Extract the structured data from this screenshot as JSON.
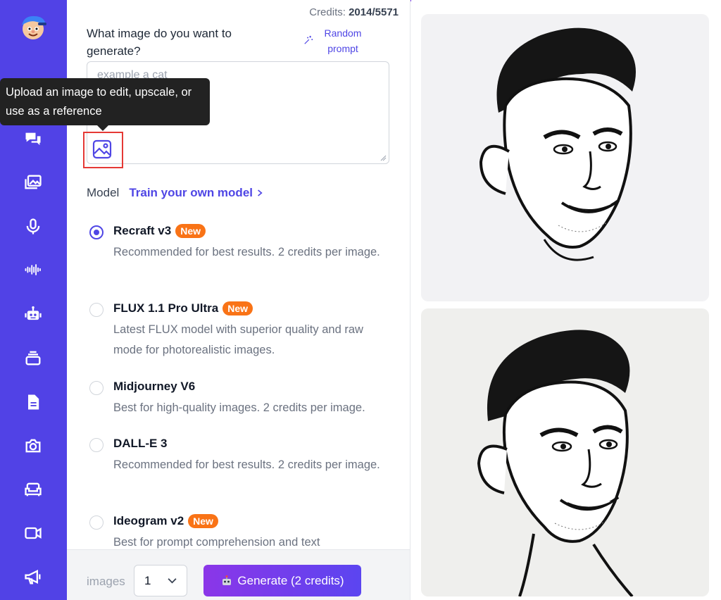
{
  "credits": {
    "label": "Credits:",
    "value": "2014/5571"
  },
  "prompt": {
    "question": "What image do you want to generate?",
    "placeholder": "example a cat",
    "value": "",
    "random_label": "Random prompt"
  },
  "tooltip": {
    "text": "Upload an image to edit, upscale, or use as a reference"
  },
  "model": {
    "label": "Model",
    "train_link": "Train your own model",
    "options": [
      {
        "name": "Recraft v3",
        "badge": "New",
        "description": "Recommended for best results. 2 credits per image.",
        "selected": true
      },
      {
        "name": "FLUX 1.1 Pro Ultra",
        "badge": "New",
        "description": "Latest FLUX model with superior quality and raw mode for photorealistic images.",
        "selected": false
      },
      {
        "name": "Midjourney V6",
        "badge": "",
        "description": "Best for high-quality images. 2 credits per image.",
        "selected": false
      },
      {
        "name": "DALL-E 3",
        "badge": "",
        "description": "Recommended for best results. 2 credits per image.",
        "selected": false
      },
      {
        "name": "Ideogram v2",
        "badge": "New",
        "description": "Best for prompt comprehension and text",
        "selected": false
      }
    ]
  },
  "footer": {
    "images_label": "images",
    "images_count": "1",
    "generate_label": "Generate (2 credits)"
  },
  "sidebar": {
    "icons": [
      "home-icon",
      "chat-icon",
      "images-icon",
      "microphone-icon",
      "waveform-icon",
      "robot-icon",
      "stack-icon",
      "document-icon",
      "camera-icon",
      "sofa-icon",
      "video-icon",
      "megaphone-icon"
    ]
  },
  "colors": {
    "sidebar": "#5142e6",
    "accent": "#4f46e5",
    "badge": "#f97316",
    "generate_start": "#8b36e8",
    "generate_end": "#5b45f0"
  }
}
